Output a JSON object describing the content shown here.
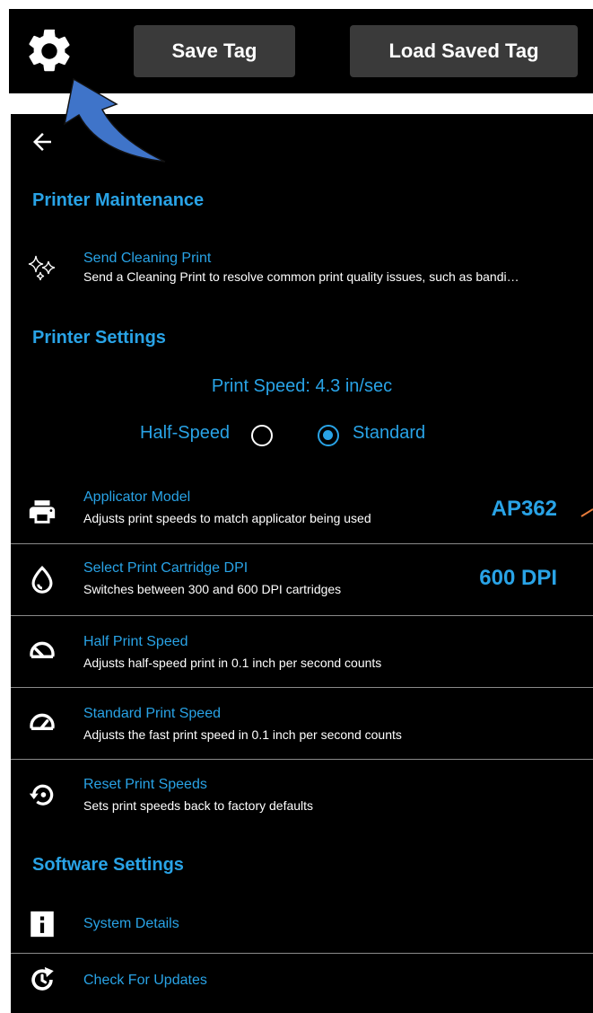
{
  "toolbar": {
    "save_label": "Save Tag",
    "load_label": "Load Saved Tag"
  },
  "sections": {
    "maintenance": "Printer Maintenance",
    "printer": "Printer Settings",
    "software": "Software Settings"
  },
  "cleaning": {
    "title": "Send Cleaning Print",
    "desc": "Send a Cleaning Print to resolve common print quality issues, such as bandi…"
  },
  "print_speed": {
    "text": "Print Speed: 4.3 in/sec",
    "half_label": "Half-Speed",
    "standard_label": "Standard",
    "selected": "Standard"
  },
  "items": [
    {
      "title": "Applicator Model",
      "desc": "Adjusts print speeds to match applicator being used",
      "value": "AP362",
      "icon": "printer-icon"
    },
    {
      "title": "Select Print Cartridge DPI",
      "desc": "Switches between 300 and 600 DPI cartridges",
      "value": "600 DPI",
      "icon": "ink-drop-icon"
    },
    {
      "title": "Half Print Speed",
      "desc": "Adjusts half-speed print in 0.1 inch per second counts",
      "icon": "speedometer-slow-icon"
    },
    {
      "title": "Standard Print Speed",
      "desc": "Adjusts the fast print speed in 0.1 inch per second counts",
      "icon": "speedometer-icon"
    },
    {
      "title": "Reset Print Speeds",
      "desc": "Sets print speeds back to factory defaults",
      "icon": "restore-icon"
    }
  ],
  "software": [
    {
      "title": "System Details",
      "icon": "info-box-icon"
    },
    {
      "title": "Check For Updates",
      "icon": "update-icon"
    }
  ],
  "colors": {
    "accent": "#29a3e6",
    "background": "#000000",
    "arrow": "#3f74c9"
  }
}
